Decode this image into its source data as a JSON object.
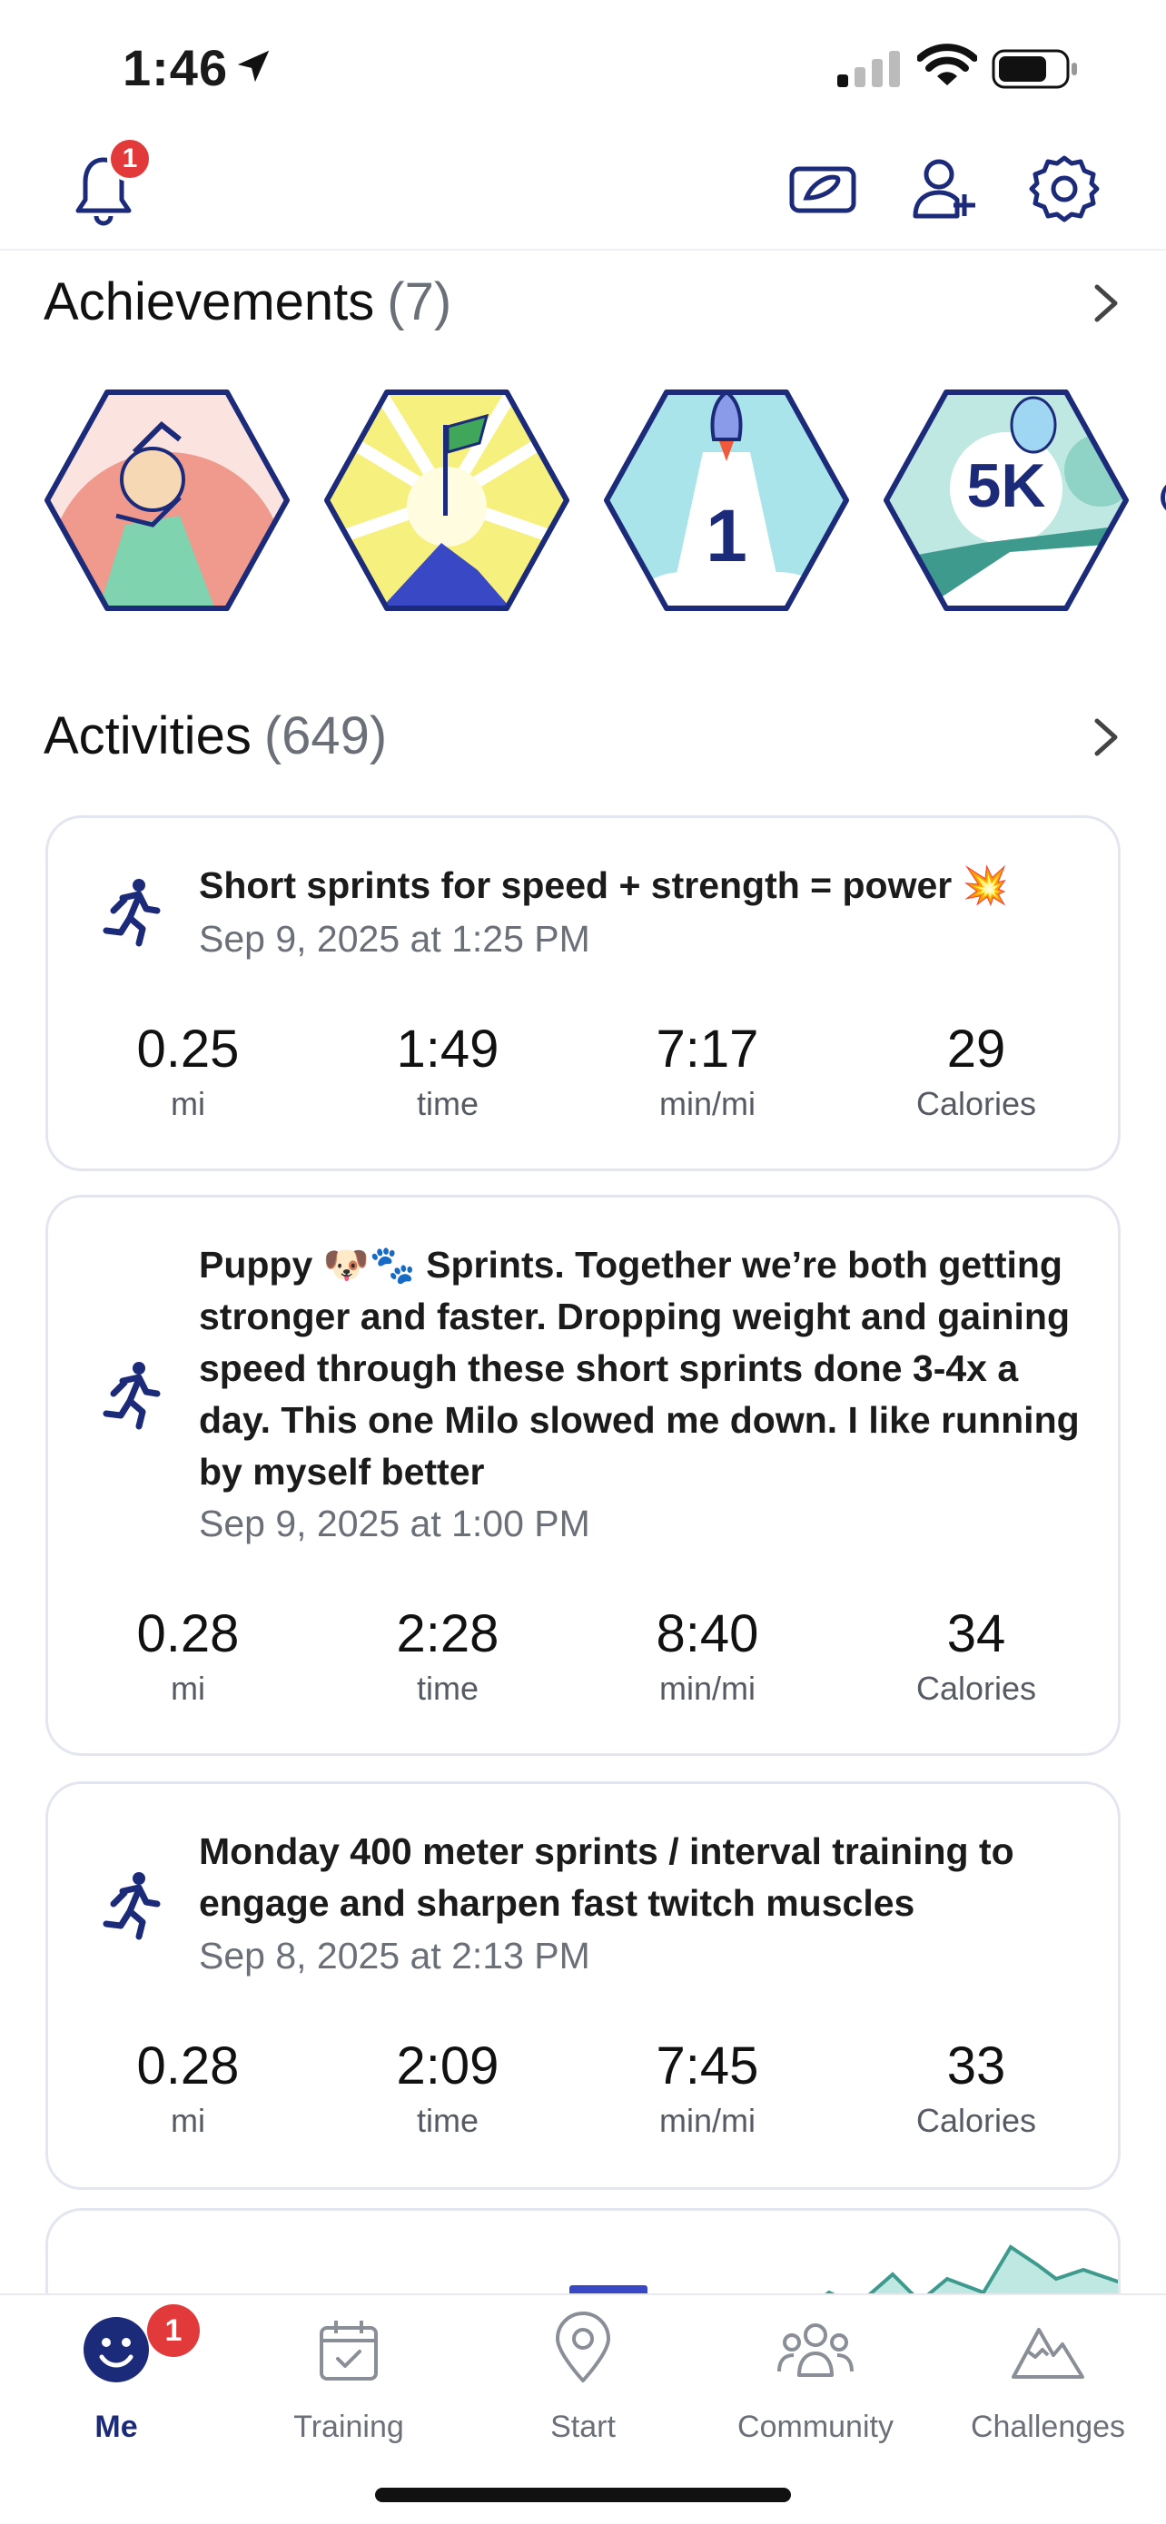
{
  "status": {
    "time": "1:46"
  },
  "top_nav": {
    "notification_count": "1"
  },
  "achievements": {
    "title": "Achievements",
    "count": "(7)",
    "badges": [
      {
        "name": "celebration-badge"
      },
      {
        "name": "summit-flag-badge"
      },
      {
        "name": "first-rocket-badge",
        "text": "1"
      },
      {
        "name": "5k-badge",
        "text": "5K"
      }
    ]
  },
  "activities": {
    "title": "Activities",
    "count": "(649)",
    "items": [
      {
        "title": "Short sprints for speed + strength = power 💥",
        "date": "Sep 9, 2025 at 1:25 PM",
        "stats": [
          {
            "value": "0.25",
            "unit": "mi"
          },
          {
            "value": "1:49",
            "unit": "time"
          },
          {
            "value": "7:17",
            "unit": "min/mi"
          },
          {
            "value": "29",
            "unit": "Calories"
          }
        ]
      },
      {
        "title": "Puppy 🐶🐾 Sprints. Together we’re both getting stronger and faster. Dropping weight and gaining speed through these short sprints done 3-4x a day. This one Milo slowed me down. I like running by myself better",
        "date": "Sep 9, 2025 at 1:00 PM",
        "stats": [
          {
            "value": "0.28",
            "unit": "mi"
          },
          {
            "value": "2:28",
            "unit": "time"
          },
          {
            "value": "8:40",
            "unit": "min/mi"
          },
          {
            "value": "34",
            "unit": "Calories"
          }
        ]
      },
      {
        "title": "Monday 400 meter sprints / interval training to engage and sharpen fast twitch muscles",
        "date": "Sep 8, 2025 at 2:13 PM",
        "stats": [
          {
            "value": "0.28",
            "unit": "mi"
          },
          {
            "value": "2:09",
            "unit": "time"
          },
          {
            "value": "7:45",
            "unit": "min/mi"
          },
          {
            "value": "33",
            "unit": "Calories"
          }
        ]
      }
    ]
  },
  "tab_bar": {
    "tabs": [
      {
        "label": "Me",
        "active": true,
        "badge": "1"
      },
      {
        "label": "Training"
      },
      {
        "label": "Start"
      },
      {
        "label": "Community"
      },
      {
        "label": "Challenges"
      }
    ]
  },
  "colors": {
    "navy": "#1c2a7a",
    "badge_red": "#e23a3a",
    "card_border": "#e3e6ef",
    "muted": "#6b6f78"
  }
}
